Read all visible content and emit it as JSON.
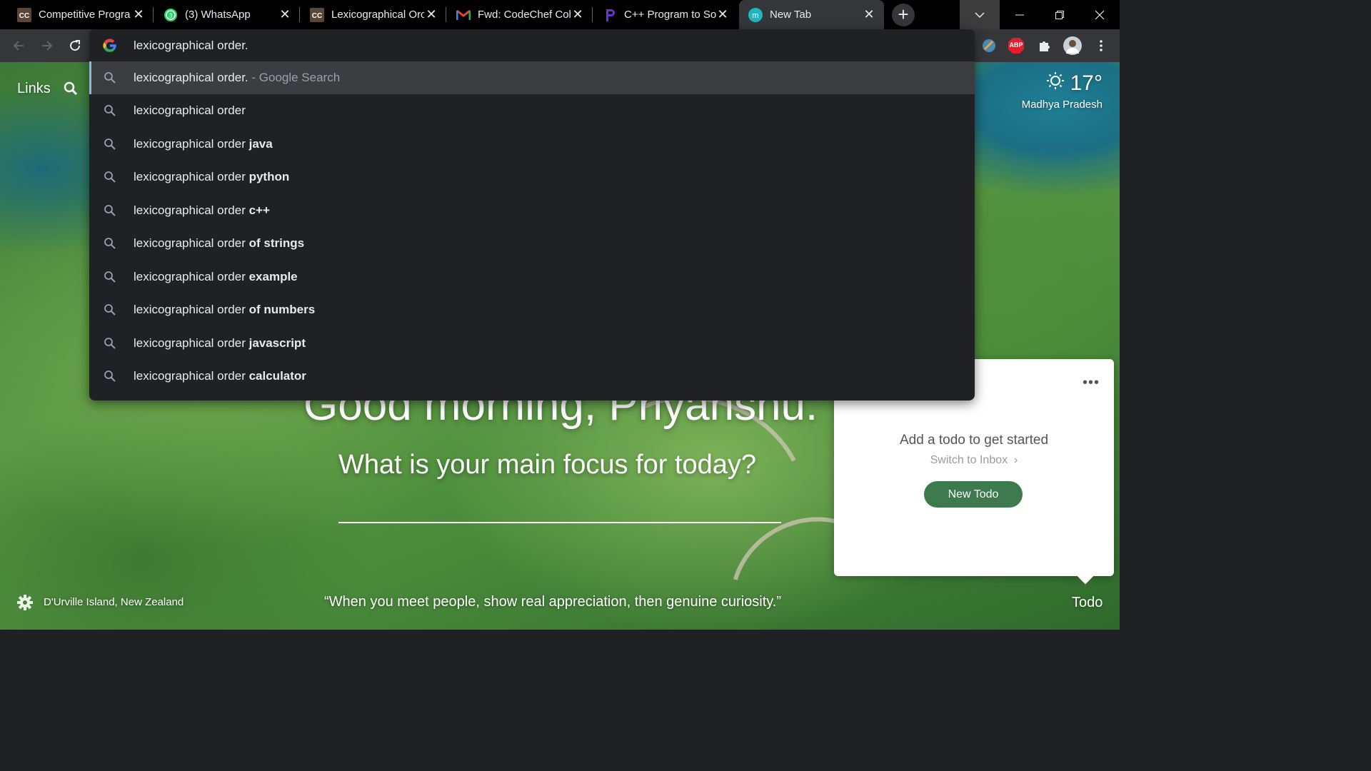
{
  "tabs": [
    {
      "title": "Competitive Progra",
      "icon": "codechef-cc-icon"
    },
    {
      "title": "(3) WhatsApp",
      "icon": "whatsapp-icon"
    },
    {
      "title": "Lexicographical Orc",
      "icon": "codechef-cc-icon"
    },
    {
      "title": "Fwd: CodeChef Coll",
      "icon": "gmail-icon"
    },
    {
      "title": "C++ Program to So",
      "icon": "prepbytes-icon"
    },
    {
      "title": "New Tab",
      "icon": "momentum-icon",
      "active": true
    }
  ],
  "omnibox": {
    "input": "lexicographical order.",
    "suggestions": [
      {
        "base": "lexicographical order.",
        "bold": "",
        "hint": " - Google Search"
      },
      {
        "base": "lexicographical order",
        "bold": "",
        "hint": ""
      },
      {
        "base": "lexicographical order ",
        "bold": "java",
        "hint": ""
      },
      {
        "base": "lexicographical order ",
        "bold": "python",
        "hint": ""
      },
      {
        "base": "lexicographical order ",
        "bold": "c++",
        "hint": ""
      },
      {
        "base": "lexicographical order ",
        "bold": "of strings",
        "hint": ""
      },
      {
        "base": "lexicographical order ",
        "bold": "example",
        "hint": ""
      },
      {
        "base": "lexicographical order ",
        "bold": "of numbers",
        "hint": ""
      },
      {
        "base": "lexicographical order ",
        "bold": "javascript",
        "hint": ""
      },
      {
        "base": "lexicographical order ",
        "bold": "calculator",
        "hint": ""
      }
    ]
  },
  "extensions": {
    "abp_label": "ABP"
  },
  "momentum": {
    "links_label": "Links",
    "weather": {
      "temp": "17°",
      "location": "Madhya Pradesh"
    },
    "greeting": "Good morning, Priyanshu.",
    "focus_question": "What is your main focus for today?",
    "quote": "“When you meet people, show real appreciation, then genuine curiosity.”",
    "photo_location": "D'Urville Island, New Zealand",
    "todo": {
      "label": "Todo",
      "empty_text": "Add a todo to get started",
      "switch_text": "Switch to Inbox",
      "new_button": "New Todo"
    }
  },
  "colors": {
    "accent": "#8ab4f8",
    "todo_button": "#3d7a4e",
    "omnibox_bg": "#202124"
  }
}
